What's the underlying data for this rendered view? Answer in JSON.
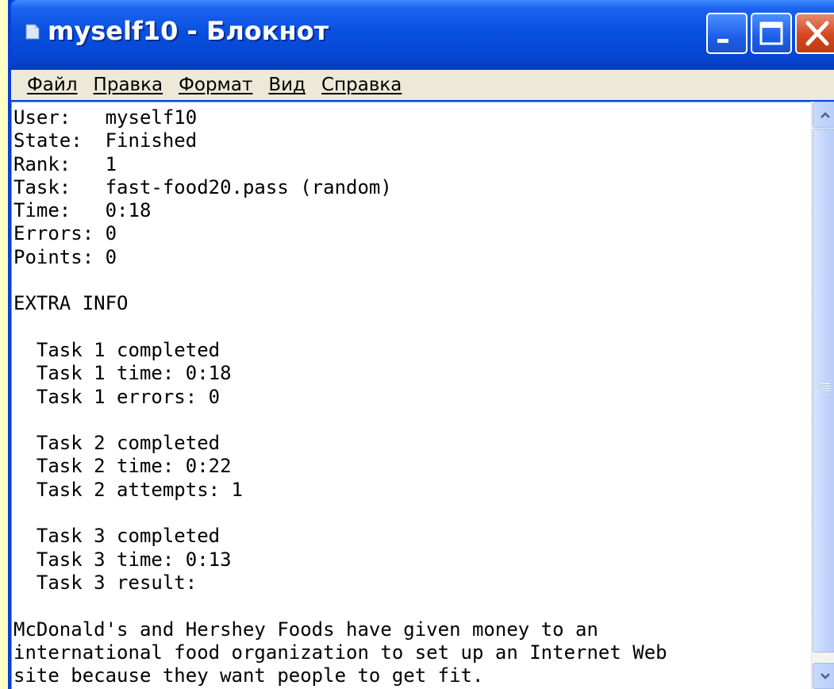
{
  "window": {
    "title": "myself10 - Блокнот",
    "app_icon": "notepad-icon",
    "controls": [
      "minimize-icon",
      "maximize-icon",
      "close-icon"
    ]
  },
  "menu": [
    {
      "label": "Файл"
    },
    {
      "label": "Правка"
    },
    {
      "label": "Формат"
    },
    {
      "label": "Вид"
    },
    {
      "label": "Справка"
    }
  ],
  "editor": {
    "lines": [
      "User:   myself10",
      "State:  Finished",
      "Rank:   1",
      "Task:   fast-food20.pass (random)",
      "Time:   0:18",
      "Errors: 0",
      "Points: 0",
      "",
      "EXTRA INFO",
      "",
      "  Task 1 completed",
      "  Task 1 time: 0:18",
      "  Task 1 errors: 0",
      "",
      "  Task 2 completed",
      "  Task 2 time: 0:22",
      "  Task 2 attempts: 1",
      "",
      "  Task 3 completed",
      "  Task 3 time: 0:13",
      "  Task 3 result:",
      "",
      "McDonald's and Hershey Foods have given money to an",
      "international food organization to set up an Internet Web",
      "site because they want people to get fit."
    ]
  },
  "scrollbar": {
    "up_icon": "scroll-up-arrow-icon",
    "down_icon": "scroll-down-arrow-icon"
  },
  "colors": {
    "titlebar": "#0A50E0",
    "desktop": "#FFFFC6",
    "menubar": "#ECE9D8",
    "close_button": "#D2471E"
  }
}
